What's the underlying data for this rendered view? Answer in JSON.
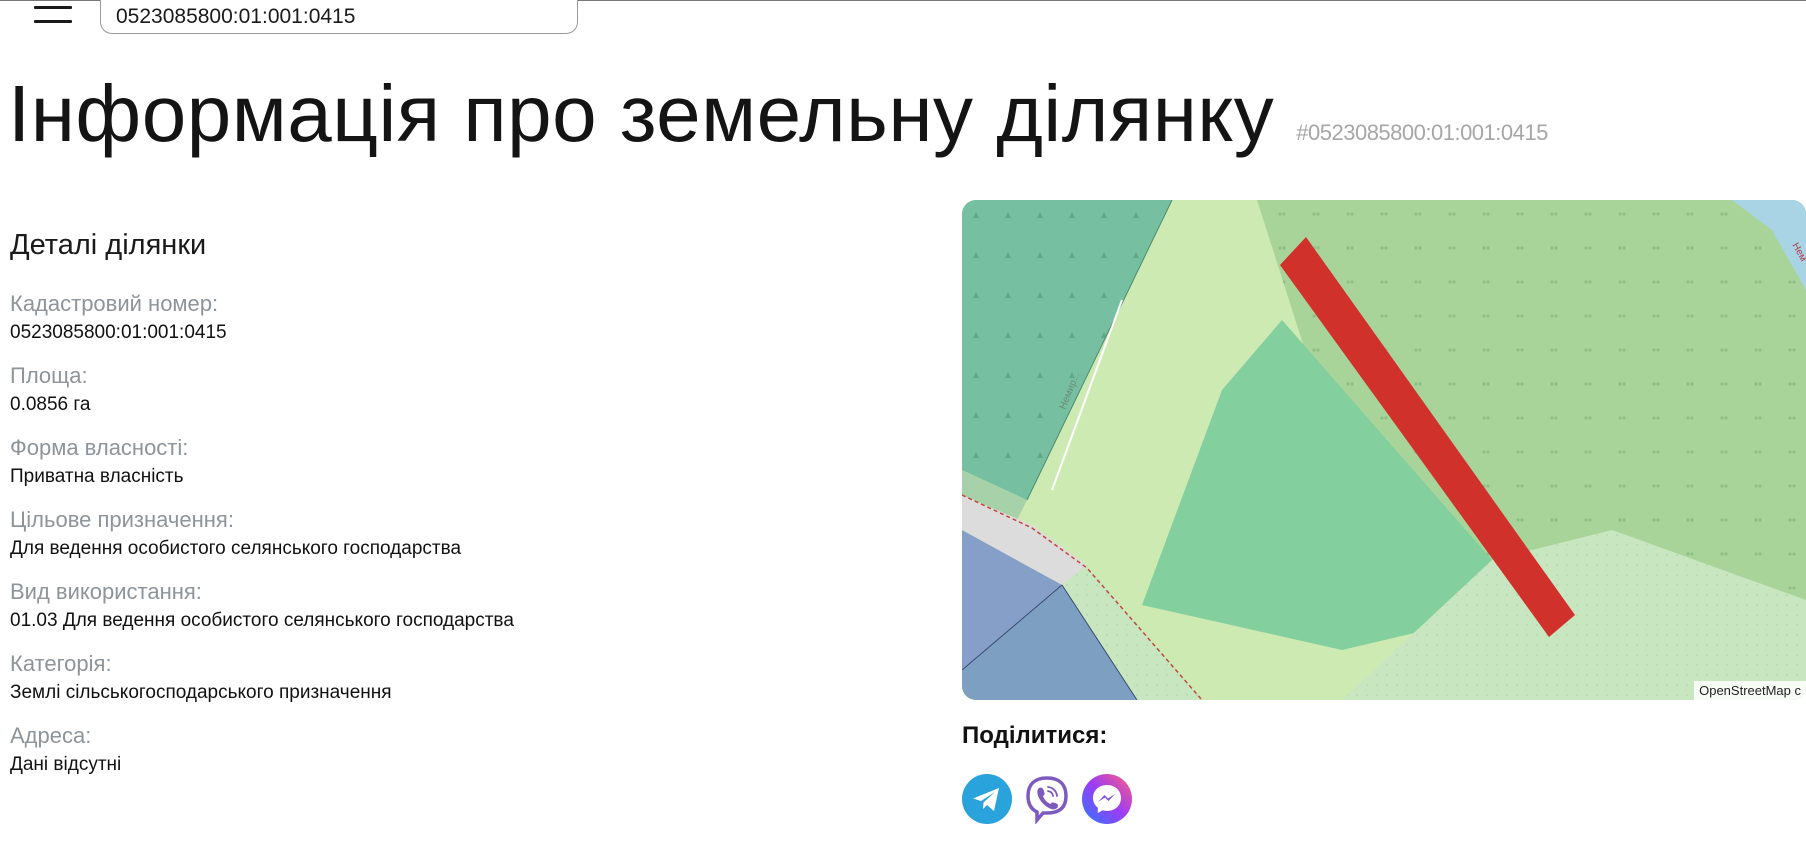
{
  "header": {
    "search": {
      "value": "0523085800:01:001:0415"
    }
  },
  "page": {
    "title": "Інформація про земельну ділянку",
    "id_tag": "#0523085800:01:001:0415"
  },
  "details": {
    "title": "Деталі ділянки",
    "fields": [
      {
        "label": "Кадастровий номер:",
        "value": "0523085800:01:001:0415"
      },
      {
        "label": "Площа:",
        "value": "0.0856 га"
      },
      {
        "label": "Форма власності:",
        "value": "Приватна власність"
      },
      {
        "label": "Цільове призначення:",
        "value": "Для ведення особистого селянського господарства"
      },
      {
        "label": "Вид використання:",
        "value": "01.03 Для ведення особистого селянського господарства"
      },
      {
        "label": "Категорія:",
        "value": "Землі сільськогосподарського призначення"
      },
      {
        "label": "Адреса:",
        "value": "Дані відсутні"
      }
    ]
  },
  "map": {
    "attribution": "OpenStreetMap c",
    "road_label_1": "Немир...",
    "road_label_2": "Нем",
    "colors": {
      "parcel": "#d0312a",
      "meadow": "#cdeab3",
      "orchard": "#a8d49a",
      "farmland": "#84cf9e",
      "forest": "#76bfa0",
      "grass": "#c8e6c0",
      "water": "#a9d4e6",
      "residential": "#859fc9",
      "road": "#dcdcdc"
    }
  },
  "share": {
    "title": "Поділитися:",
    "telegram_color": "#2aa3dc",
    "viber_color": "#7d5bbe",
    "messenger_color": "#7b4df2"
  }
}
